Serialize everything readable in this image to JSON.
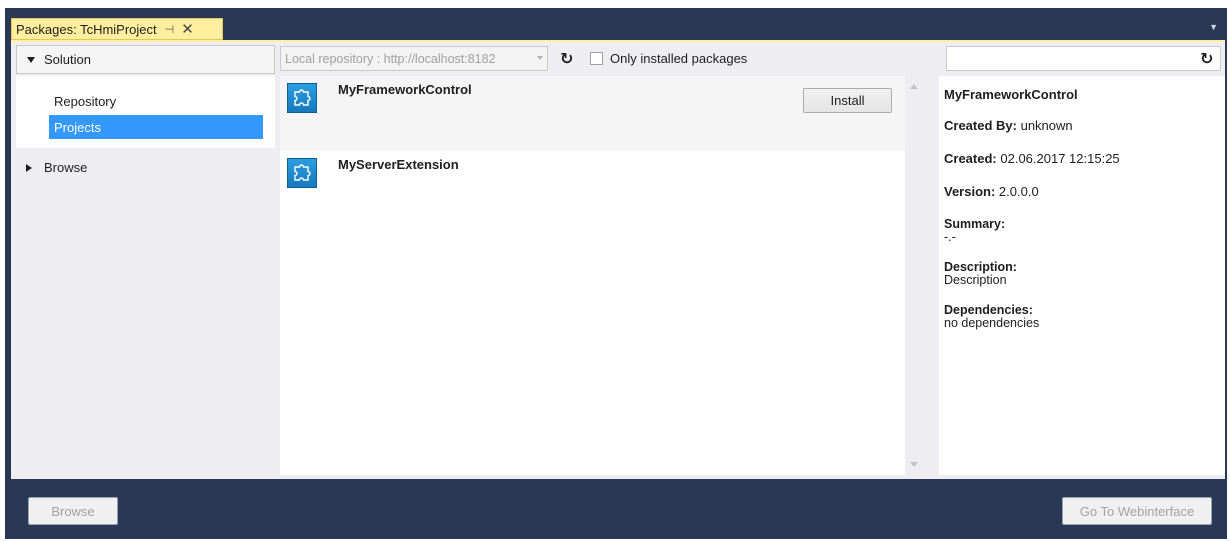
{
  "tab": {
    "title": "Packages: TcHmiProject",
    "pin_glyph": "⊣",
    "close_glyph": "✕"
  },
  "left": {
    "solution_label": "Solution",
    "items": [
      {
        "label": "Repository",
        "selected": false
      },
      {
        "label": "Projects",
        "selected": true
      }
    ],
    "browse_label": "Browse"
  },
  "toolbar": {
    "repository_value": "Local repository : http://localhost:8182",
    "only_installed_label": "Only installed packages",
    "only_installed_checked": false
  },
  "packages": [
    {
      "name": "MyFrameworkControl",
      "action_label": "Install",
      "selected": true,
      "icon": "puzzle-icon"
    },
    {
      "name": "MyServerExtension",
      "selected": false,
      "icon": "puzzle-icon"
    }
  ],
  "details": {
    "search_value": "",
    "title": "MyFrameworkControl",
    "created_by_label": "Created By:",
    "created_by_value": "unknown",
    "created_label": "Created:",
    "created_value": "02.06.2017 12:15:25",
    "version_label": "Version:",
    "version_value": "2.0.0.0",
    "summary_label": "Summary:",
    "summary_value": "-.-",
    "description_label": "Description:",
    "description_value": "Description",
    "dependencies_label": "Dependencies:",
    "dependencies_value": "no dependencies"
  },
  "footer": {
    "browse_label": "Browse",
    "webinterface_label": "Go To Webinterface"
  },
  "colors": {
    "chrome": "#293955",
    "tab_active": "#ffef9e",
    "selection": "#3399ff",
    "panel": "#eeeef2"
  }
}
